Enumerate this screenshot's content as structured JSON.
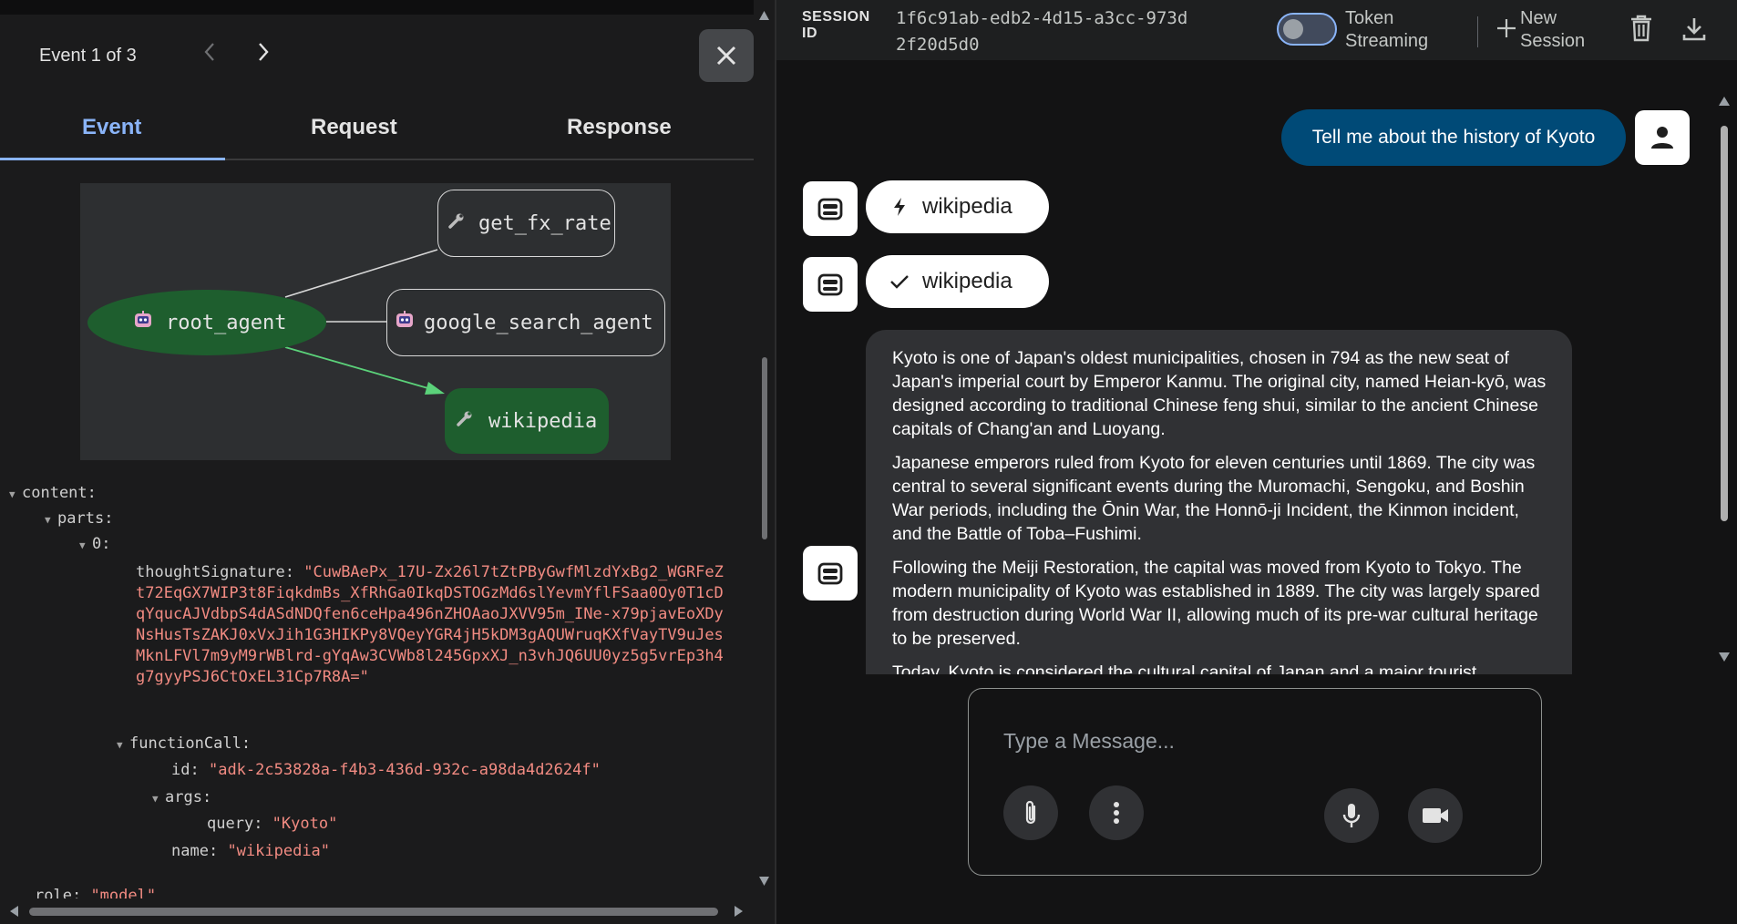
{
  "event_panel": {
    "counter": "Event 1 of 3",
    "tabs": [
      "Event",
      "Request",
      "Response"
    ],
    "graph_nodes": {
      "root": "root_agent",
      "fx": "get_fx_rate",
      "search": "google_search_agent",
      "wiki": "wikipedia"
    },
    "tree": {
      "content_key": "content",
      "parts_key": "parts",
      "index_key": "0",
      "thought_key": "thoughtSignature",
      "thought_value": "\"CuwBAePx_17U-Zx26l7tZtPByGwfMlzdYxBg2_WGRFeZt72EqGX7WIP3t8FiqkdmBs_XfRhGa0IkqDSTOGzMd6slYevmYflFSaa0Oy0T1cDqYqucAJVdbpS4dASdNDQfen6ceHpa496nZHOAaoJXVV95m_INe-x79pjavEoXDyNsHusTsZAKJ0xVxJih1G3HIKPy8VQeyYGR4jH5kDM3gAQUWruqKXfVayTV9uJesMknLFVl7m9yM9rWBlrd-gYqAw3CVWb8l245GpxXJ_n3vhJQ6UU0yz5g5vrEp3h4g7gyyPSJ6CtOxEL31Cp7R8A=\"",
      "function_call_key": "functionCall",
      "id_key": "id",
      "id_value": "\"adk-2c53828a-f4b3-436d-932c-a98da4d2624f\"",
      "args_key": "args",
      "query_key": "query",
      "query_value": "\"Kyoto\"",
      "name_key": "name",
      "name_value": "\"wikipedia\"",
      "role_key": "role",
      "role_value": "\"model\""
    }
  },
  "header": {
    "session_label": "SESSION ID",
    "session_id": "1f6c91ab-edb2-4d15-a3cc-973d2f20d5d0",
    "token_streaming": "Token Streaming",
    "new_session": "New Session"
  },
  "chat": {
    "user_message": "Tell me about the history of Kyoto",
    "function_call_chip": "wikipedia",
    "function_response_chip": "wikipedia",
    "response_paragraphs": [
      "Kyoto is one of Japan's oldest municipalities, chosen in 794 as the new seat of Japan's imperial court by Emperor Kanmu. The original city, named Heian-kyō, was designed according to traditional Chinese feng shui, similar to the ancient Chinese capitals of Chang'an and Luoyang.",
      "Japanese emperors ruled from Kyoto for eleven centuries until 1869. The city was central to several significant events during the Muromachi, Sengoku, and Boshin War periods, including the Ōnin War, the Honnō-ji Incident, the Kinmon incident, and the Battle of Toba–Fushimi.",
      "Following the Meiji Restoration, the capital was moved from Kyoto to Tokyo. The modern municipality of Kyoto was established in 1889. The city was largely spared from destruction during World War II, allowing much of its pre-war cultural heritage to be preserved.",
      "Today, Kyoto is considered the cultural capital of Japan and a major tourist destination."
    ],
    "input_placeholder": "Type a Message..."
  },
  "colors": {
    "accent": "#8ab4f8",
    "user_bubble": "#004a77",
    "node_active": "#1e5e2e",
    "string_value": "#f28b82",
    "edge_active": "#5bd27a"
  }
}
